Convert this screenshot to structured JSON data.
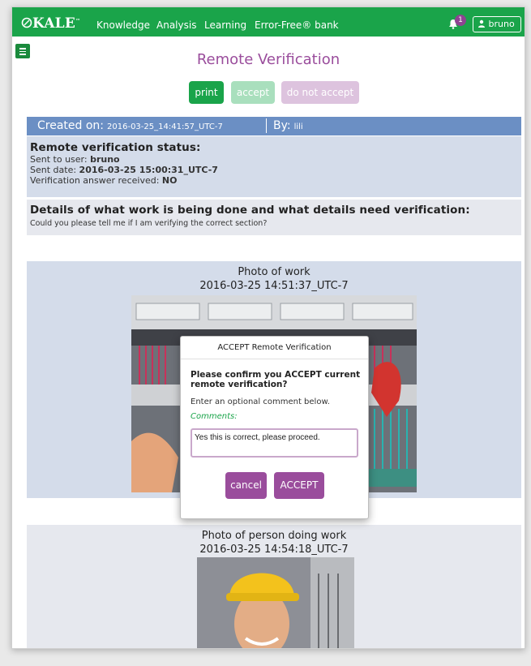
{
  "app": {
    "brand": "KALE",
    "trademark": "™",
    "nav": [
      "Knowledge",
      "Analysis",
      "Learning",
      "Error-Free® bank"
    ],
    "notification_count": "1",
    "user": "bruno"
  },
  "page": {
    "title": "Remote Verification",
    "buttons": {
      "print": "print",
      "accept": "accept",
      "do_not_accept": "do not accept"
    }
  },
  "created": {
    "label": "Created on:",
    "date": "2016-03-25_14:41:57_UTC-7",
    "by_label": "By:",
    "by": "lili"
  },
  "status": {
    "heading": "Remote verification status:",
    "sent_to_label": "Sent to user:",
    "sent_to": "bruno",
    "sent_date_label": "Sent date:",
    "sent_date": "2016-03-25 15:00:31_UTC-7",
    "answer_label": "Verification answer received:",
    "answer": "NO"
  },
  "details": {
    "heading": "Details of what work is being done and what details need verification:",
    "text": "Could you please tell me if I am verifying the correct section?"
  },
  "photo_work": {
    "title": "Photo of work",
    "date": "2016-03-25 14:51:37_UTC-7"
  },
  "photo_person": {
    "title": "Photo of person doing work",
    "date": "2016-03-25 14:54:18_UTC-7"
  },
  "modal": {
    "title": "ACCEPT Remote Verification",
    "question": "Please confirm you ACCEPT current remote verification?",
    "hint": "Enter an optional comment below.",
    "comments_label": "Comments:",
    "comment_value": "Yes this is correct, please proceed.",
    "cancel": "cancel",
    "accept": "ACCEPT"
  },
  "colors": {
    "nav_green": "#1aa44a",
    "accent_purple": "#9a4d9c",
    "bar_blue": "#6b8fc4",
    "panel_blue": "#d4dcea"
  }
}
